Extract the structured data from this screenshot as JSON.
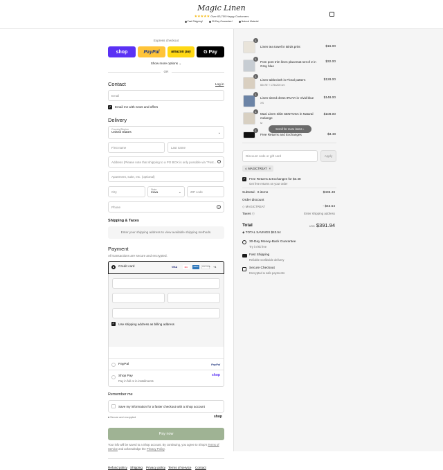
{
  "header": {
    "logo": "Magic Linen",
    "stars": "★★★★★",
    "customers": "Over 63,700 Happy Customers",
    "perks": [
      "Fast Shipping!",
      "30-Day Guarantee!",
      "Natural Material"
    ]
  },
  "express": {
    "label": "Express checkout",
    "shop": "shop",
    "paypal": "PayPal",
    "amazon": "amazon pay",
    "gpay": "G Pay",
    "more": "Show more options",
    "or": "OR"
  },
  "contact": {
    "title": "Contact",
    "login": "Log in",
    "email_placeholder": "Email",
    "news": "Email me with news and offers"
  },
  "delivery": {
    "title": "Delivery",
    "country_label": "Country/Region",
    "country": "United States",
    "first": "First name",
    "last": "Last name",
    "address": "Address (Please note that shipping to a PO BOX is only possible via \"Post...",
    "apt": "Apartment, suite, etc. (optional)",
    "city": "City",
    "state_label": "State",
    "state": "Iowa",
    "zip": "ZIP code",
    "phone": "Phone"
  },
  "shipping": {
    "title": "Shipping & Taxes",
    "note": "Enter your shipping address to view available shipping methods."
  },
  "payment": {
    "title": "Payment",
    "sub": "All transactions are secure and encrypted.",
    "credit": "Credit card",
    "cards": [
      "VISA",
      "MC",
      "AMEX",
      "DISCOVER",
      "+4"
    ],
    "billing": "Use shipping address as billing address",
    "paypal": "PayPal",
    "paypal_logo": "PayPal",
    "shoppay": "Shop Pay",
    "shoppay_sub": "Pay in full or in installments",
    "shop_logo": "shop"
  },
  "remember": {
    "title": "Remember me",
    "save": "Save my information for a faster checkout with a Shop account",
    "secure": "Secure and encrypted",
    "shop": "shop"
  },
  "pay": {
    "label": "Pay now",
    "legal1": "Your info will be saved to a Shop account. By continuing, you agree to Shop's",
    "tos": "Terms of Service",
    "legal2": "and acknowledge the",
    "privacy": "Privacy Policy"
  },
  "footer": [
    "Refund policy",
    "Shipping",
    "Privacy policy",
    "Terms of service",
    "Contact"
  ],
  "cart": {
    "items": [
      {
        "qty": "1",
        "name": "Linen tea towel in Birds print",
        "variant": "",
        "price": "$16.00",
        "color": "#e9e4da"
      },
      {
        "qty": "1",
        "name": "Pom pom trim linen placemat set of 2 in Gray blue",
        "variant": "",
        "price": "$32.00",
        "color": "#c7cdd3"
      },
      {
        "qty": "1",
        "name": "Linen tablecloth in Floral pattern",
        "variant": "60x78\" / 175x200 cm",
        "price": "$128.00",
        "color": "#d9cfc0"
      },
      {
        "qty": "1",
        "name": "Linen tiered dress IRUYA in Vivid blue",
        "variant": "XS",
        "price": "$148.00",
        "color": "#6c84a6"
      },
      {
        "qty": "1",
        "name": "Maxi Linen Skirt SENTOSA in Natural melange",
        "variant": "M",
        "price": "$108.00",
        "color": "#d8d0c2"
      },
      {
        "qty": "1",
        "name": "Free Returns and Exchanges",
        "variant": "",
        "price": "$3.48",
        "color": "#111111"
      }
    ],
    "scroll_tip": "Scroll for more items",
    "discount_placeholder": "Discount code or gift card",
    "apply": "Apply",
    "code_tag": "MAGICTREAT",
    "free_returns": "Free Returns & Exchanges for $3.48",
    "free_returns_sub": "Get free returns on your order",
    "subtotal_label": "Subtotal · 6 items",
    "subtotal": "$435.48",
    "order_discount": "Order discount",
    "discount_code": "MAGICTREAT",
    "discount_value": "- $43.54",
    "taxes_label": "Taxes",
    "taxes_value": "Enter shipping address",
    "total_label": "Total",
    "currency": "USD",
    "total": "$391.94",
    "savings_label": "TOTAL SAVINGS",
    "savings": "$43.54",
    "benefits": [
      {
        "title": "30-Day Money-Back Guarantee",
        "sub": "Try it risk free"
      },
      {
        "title": "Fast Shipping",
        "sub": "Reliable worldwide delivery"
      },
      {
        "title": "Secure Checkout",
        "sub": "Encrypted & safe payments"
      }
    ]
  },
  "colors": {
    "accent": "#5a31f4",
    "paypal": "#ffc439",
    "amazon": "#ffd814",
    "pay_btn": "#9fb394"
  }
}
